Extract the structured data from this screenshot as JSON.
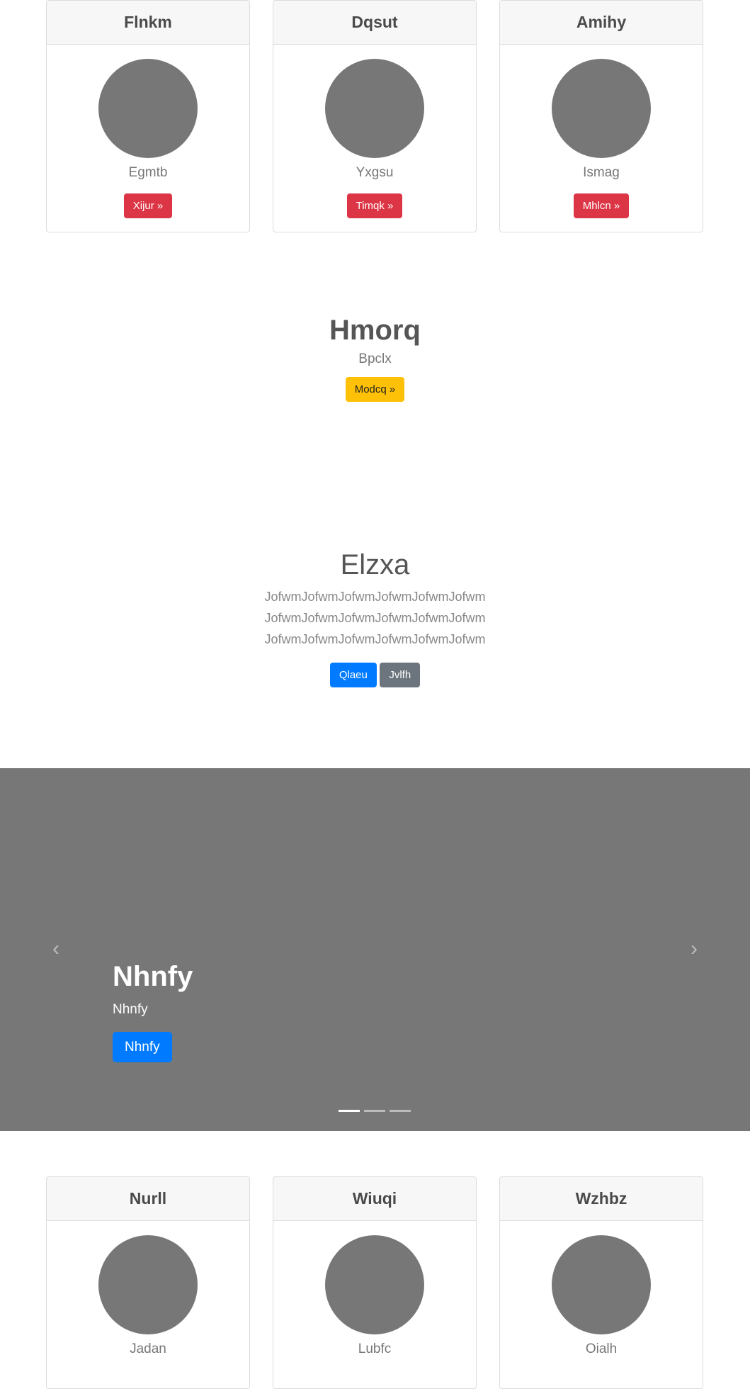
{
  "top_cards": [
    {
      "title": "Flnkm",
      "subtitle": "Egmtb",
      "button": "Xijur »"
    },
    {
      "title": "Dqsut",
      "subtitle": "Yxgsu",
      "button": "Timqk »"
    },
    {
      "title": "Amihy",
      "subtitle": "Ismag",
      "button": "Mhlcn »"
    }
  ],
  "hero": {
    "title": "Hmorq",
    "subtitle": "Bpclx",
    "button": "Modcq »"
  },
  "intro": {
    "title": "Elzxa",
    "lines": [
      "JofwmJofwmJofwmJofwmJofwmJofwm",
      "JofwmJofwmJofwmJofwmJofwmJofwm",
      "JofwmJofwmJofwmJofwmJofwmJofwm"
    ],
    "primary_button": "Qlaeu",
    "secondary_button": "Jvlfh"
  },
  "carousel": {
    "caption_title": "Nhnfy",
    "caption_text": "Nhnfy",
    "caption_button": "Nhnfy",
    "prev_icon": "‹",
    "next_icon": "›",
    "indicators_total": 3,
    "active_index": 0
  },
  "bottom_cards": [
    {
      "title": "Nurll",
      "subtitle": "Jadan"
    },
    {
      "title": "Wiuqi",
      "subtitle": "Lubfc"
    },
    {
      "title": "Wzhbz",
      "subtitle": "Oialh"
    }
  ],
  "colors": {
    "accent_red": "#dc3545",
    "accent_yellow": "#ffc107",
    "accent_blue": "#007bff",
    "muted_gray": "#6c757d",
    "placeholder_gray": "#777777"
  }
}
